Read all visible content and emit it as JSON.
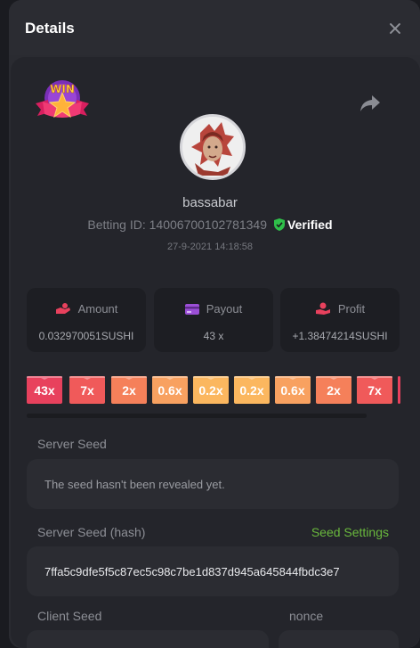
{
  "dialog": {
    "title": "Details"
  },
  "player": {
    "username": "bassabar",
    "betting_id_label": "Betting ID:",
    "betting_id": "14006700102781349",
    "verified_label": "Verified",
    "timestamp": "27-9-2021 14:18:58",
    "badge_text": "WIN"
  },
  "stats": [
    {
      "label": "Amount",
      "value": "0.032970051SUSHI",
      "icon": "hand-coins-icon",
      "icon_color": "#e8415d"
    },
    {
      "label": "Payout",
      "value": "43 x",
      "icon": "card-icon",
      "icon_color": "#9b4fd6"
    },
    {
      "label": "Profit",
      "value": "+1.38474214SUSHI",
      "icon": "hand-money-icon",
      "icon_color": "#e8415d"
    }
  ],
  "multipliers": [
    {
      "label": "43x",
      "color": "#e8415d"
    },
    {
      "label": "7x",
      "color": "#f05a5a"
    },
    {
      "label": "2x",
      "color": "#f5805a"
    },
    {
      "label": "0.6x",
      "color": "#f8a160"
    },
    {
      "label": "0.2x",
      "color": "#fbb75f"
    },
    {
      "label": "0.2x",
      "color": "#fbb75f"
    },
    {
      "label": "0.6x",
      "color": "#f8a160"
    },
    {
      "label": "2x",
      "color": "#f5805a"
    },
    {
      "label": "7x",
      "color": "#f05a5a"
    },
    {
      "label": "",
      "color": "#e8415d"
    }
  ],
  "fields": {
    "server_seed_label": "Server Seed",
    "server_seed_value": "The seed hasn't been revealed yet.",
    "server_seed_hash_label": "Server Seed (hash)",
    "seed_settings_label": "Seed Settings",
    "server_seed_hash_value": "7ffa5c9dfe5f5c87ec5c98c7be1d837d945a645844fbdc3e7",
    "client_seed_label": "Client Seed",
    "nonce_label": "nonce"
  }
}
